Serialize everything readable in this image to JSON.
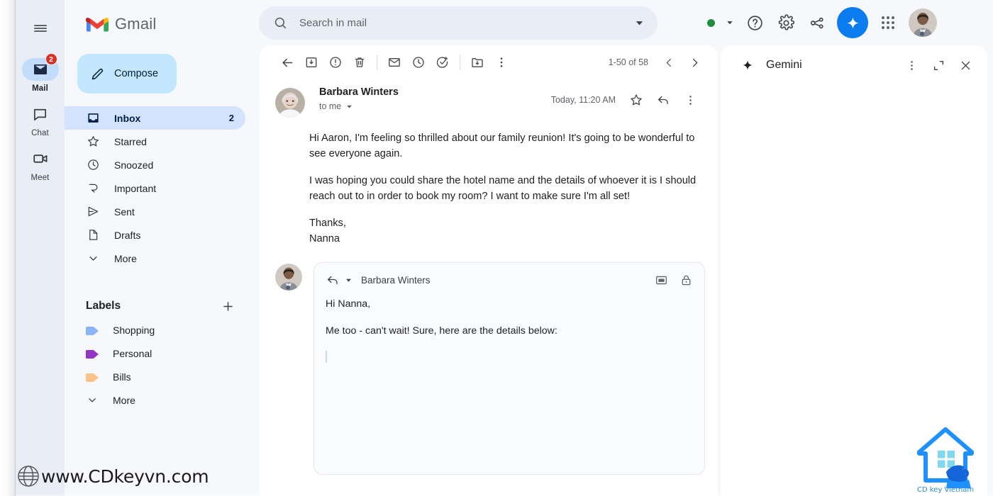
{
  "app": {
    "brand": "Gmail",
    "hamburger_icon": "hamburger-menu-icon"
  },
  "rail": {
    "items": [
      {
        "label": "Mail",
        "icon": "mail-icon",
        "badge": "2",
        "active": true
      },
      {
        "label": "Chat",
        "icon": "chat-bubble-icon",
        "badge": "",
        "active": false
      },
      {
        "label": "Meet",
        "icon": "video-camera-icon",
        "badge": "",
        "active": false
      }
    ]
  },
  "sidebar": {
    "compose_label": "Compose",
    "compose_icon": "pencil-icon",
    "nav": [
      {
        "label": "Inbox",
        "icon": "inbox-icon",
        "count": "2",
        "active": true
      },
      {
        "label": "Starred",
        "icon": "star-icon",
        "count": "",
        "active": false
      },
      {
        "label": "Snoozed",
        "icon": "clock-icon",
        "count": "",
        "active": false
      },
      {
        "label": "Important",
        "icon": "important-label-icon",
        "count": "",
        "active": false
      },
      {
        "label": "Sent",
        "icon": "send-icon",
        "count": "",
        "active": false
      },
      {
        "label": "Drafts",
        "icon": "draft-page-icon",
        "count": "",
        "active": false
      },
      {
        "label": "More",
        "icon": "chevron-down-icon",
        "count": "",
        "active": false
      }
    ],
    "labels_title": "Labels",
    "labels_add_icon": "plus-icon",
    "labels": [
      {
        "label": "Shopping",
        "color": "#8ab4f8"
      },
      {
        "label": "Personal",
        "color": "#9334c4"
      },
      {
        "label": "Bills",
        "color": "#fbc28a"
      }
    ],
    "labels_more": "More",
    "labels_more_icon": "chevron-down-icon"
  },
  "search": {
    "placeholder": "Search in mail",
    "value": "",
    "search_icon": "search-icon",
    "options_icon": "chevron-down-icon"
  },
  "topbar": {
    "status_icon": "green-status-dot",
    "status_caret_icon": "caret-down-icon",
    "help_icon": "help-circle-icon",
    "settings_icon": "gear-icon",
    "apps_nodes_icon": "workspace-nodes-icon",
    "gemini_icon": "gemini-sparkle-icon",
    "apps_grid_icon": "apps-grid-icon",
    "avatar_icon": "account-avatar"
  },
  "mail_toolbar": {
    "back_icon": "back-arrow-icon",
    "archive_icon": "archive-icon",
    "report_spam_icon": "report-spam-icon",
    "delete_icon": "trash-icon",
    "mark_unread_icon": "mark-unread-envelope-icon",
    "snooze_icon": "snooze-clock-icon",
    "add_task_icon": "add-to-tasks-icon",
    "move_to_icon": "move-to-folder-icon",
    "more_icon": "more-vertical-icon",
    "range": "1-50 of 58",
    "prev_icon": "chevron-left-icon",
    "next_icon": "chevron-right-icon"
  },
  "message": {
    "sender": "Barbara Winters",
    "recipient": "to me",
    "recipient_caret_icon": "caret-down-icon",
    "time": "Today, 11:20 AM",
    "star_icon": "star-outline-icon",
    "reply_icon": "reply-arrow-icon",
    "more_icon": "more-vertical-icon",
    "avatar_icon": "sender-avatar",
    "paragraphs": [
      "Hi Aaron,  I'm feeling so thrilled about our family reunion! It's going to be wonderful to see everyone again.",
      "I was hoping you could share the hotel name and the details of whoever it is I should reach out to in order to book my room? I want to make sure I'm all set!"
    ],
    "signoff": "Thanks,",
    "signature": "Nanna"
  },
  "reply": {
    "mode_icon": "reply-arrow-icon",
    "mode_caret_icon": "caret-down-icon",
    "to": "Barbara Winters",
    "popout_icon": "pop-out-window-icon",
    "confidential_icon": "lock-icon",
    "avatar_icon": "user-avatar",
    "lines": [
      "Hi Nanna,",
      "Me too - can't wait! Sure, here are the details below:"
    ]
  },
  "gemini": {
    "title": "Gemini",
    "sparkle_icon": "gemini-sparkle-icon",
    "more_icon": "more-vertical-icon",
    "expand_icon": "expand-icon",
    "close_icon": "close-x-icon"
  },
  "watermark": {
    "site": "www.CDkeyvn.com",
    "globe_icon": "globe-icon",
    "logo_caption": "CD key Vietnam",
    "logo_icon": "house-key-logo"
  },
  "colors": {
    "accent_blue": "#0b7cf0",
    "compose_bg": "#c2e7ff",
    "active_nav_bg": "#d3e3fd",
    "rail_bg": "#e9edf6",
    "badge_red": "#d93025",
    "status_green": "#1e8e3e"
  }
}
